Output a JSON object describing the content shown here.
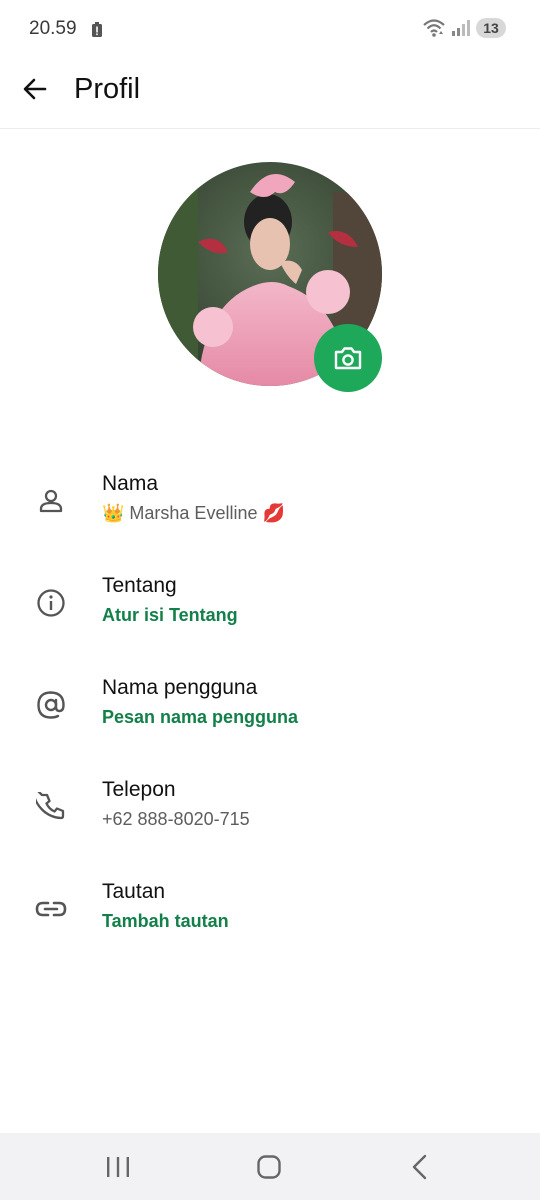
{
  "status": {
    "time": "20.59",
    "notification_count": "13"
  },
  "header": {
    "title": "Profil"
  },
  "colors": {
    "accent": "#1ea85a",
    "link_green": "#13804a"
  },
  "profile": {
    "fields": [
      {
        "label": "Nama",
        "value": "👑 Marsha Evelline 💋",
        "icon": "person-icon"
      },
      {
        "label": "Tentang",
        "value": "Atur isi Tentang",
        "icon": "info-icon"
      },
      {
        "label": "Nama pengguna",
        "value": "Pesan nama pengguna",
        "icon": "at-sign-icon"
      },
      {
        "label": "Telepon",
        "value": "+62 888-8020-715",
        "icon": "phone-icon"
      },
      {
        "label": "Tautan",
        "value": "Tambah tautan",
        "icon": "link-icon"
      }
    ]
  }
}
